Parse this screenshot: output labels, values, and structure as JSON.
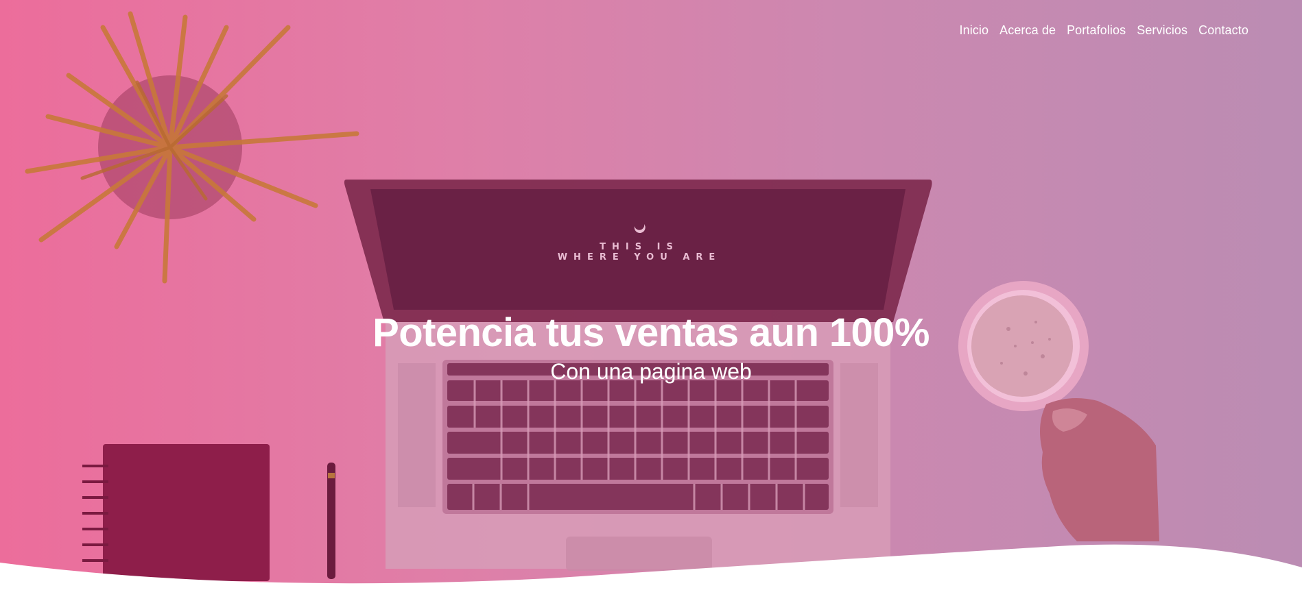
{
  "nav": {
    "items": [
      {
        "label": "Inicio"
      },
      {
        "label": "Acerca de"
      },
      {
        "label": "Portafolios"
      },
      {
        "label": "Servicios"
      },
      {
        "label": "Contacto"
      }
    ]
  },
  "hero": {
    "title": "Potencia tus ventas aun 100%",
    "subtitle": "Con una pagina web",
    "screen_text_line1": "THIS IS",
    "screen_text_line2": "WHERE YOU ARE"
  },
  "colors": {
    "overlay_left": "#ec6d9b",
    "overlay_right": "#bb8cb3",
    "text": "#ffffff",
    "bottom": "#ffffff"
  }
}
